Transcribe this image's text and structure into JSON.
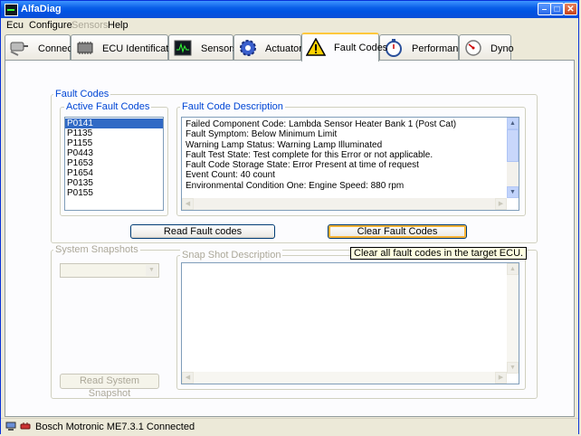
{
  "window": {
    "title": "AlfaDiag"
  },
  "menu": [
    "Ecu",
    "Configure",
    "Sensors",
    "Help"
  ],
  "tabs": [
    {
      "label": "Connect",
      "icon": "connect-icon"
    },
    {
      "label": "ECU Identification",
      "icon": "chip-icon"
    },
    {
      "label": "Sensors",
      "icon": "oscilloscope-icon"
    },
    {
      "label": "Actuators",
      "icon": "gear-icon"
    },
    {
      "label": "Fault Codes",
      "icon": "warning-icon",
      "active": true
    },
    {
      "label": "Performance",
      "icon": "stopwatch-icon"
    },
    {
      "label": "Dyno",
      "icon": "gauge-icon"
    }
  ],
  "fault_codes": {
    "group_title": "Fault Codes",
    "active_title": "Active Fault Codes",
    "codes": [
      "P0141",
      "P1135",
      "P1155",
      "P0443",
      "P1653",
      "P1654",
      "P0135",
      "P0155"
    ],
    "selected_code": "P0141",
    "description_title": "Fault Code Description",
    "description_lines": [
      "Failed Component Code: Lambda Sensor Heater Bank 1 (Post Cat)",
      "Fault Symptom: Below Minimum Limit",
      "Warning Lamp Status: Warning Lamp Illuminated",
      "Fault Test State: Test complete for this Error or not applicable.",
      "Fault Code Storage State: Error Present at time of request",
      "Event Count: 40 count",
      "Environmental Condition One: Engine Speed: 880 rpm"
    ],
    "read_button": "Read Fault codes",
    "clear_button": "Clear Fault Codes",
    "clear_tooltip": "Clear all fault codes in the target ECU."
  },
  "snapshots": {
    "group_title": "System Snapshots",
    "description_title": "Snap Shot Description",
    "read_button": "Read System Snapshot"
  },
  "status": {
    "text": "Bosch Motronic ME7.3.1 Connected"
  },
  "colors": {
    "titlebar": "#0054e3",
    "selection": "#316ac5",
    "group_title": "#0046d5",
    "tab_highlight": "#ffc83c"
  }
}
